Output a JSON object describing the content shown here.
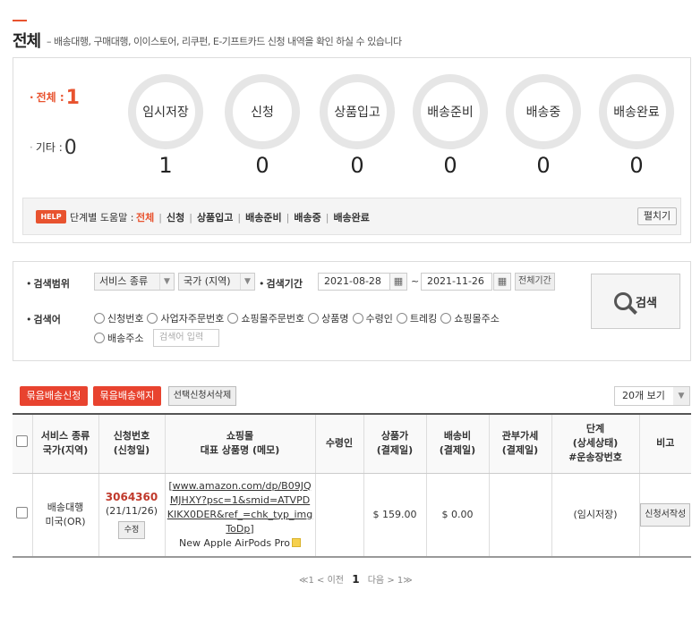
{
  "header": {
    "title": "전체",
    "description": "– 배송대행, 구매대행, 이이스토어, 리쿠펀, E-기프트카드 신청 내역을 확인 하실 수 있습니다"
  },
  "summary": {
    "total_label": "전체 :",
    "total_count": "1",
    "other_label": "기타 :",
    "other_count": "0",
    "stages": [
      {
        "label": "임시저장",
        "count": "1"
      },
      {
        "label": "신청",
        "count": "0"
      },
      {
        "label": "상품입고",
        "count": "0"
      },
      {
        "label": "배송준비",
        "count": "0"
      },
      {
        "label": "배송중",
        "count": "0"
      },
      {
        "label": "배송완료",
        "count": "0"
      }
    ]
  },
  "help": {
    "badge": "HELP",
    "label": "단계별 도움말 :",
    "links": [
      "전체",
      "신청",
      "상품입고",
      "배송준비",
      "배송중",
      "배송완료"
    ],
    "fold_button": "펼치기"
  },
  "search": {
    "range_label": "검색범위",
    "service_select": "서비스 종류",
    "country_select": "국가 (지역)",
    "period_label": "검색기간",
    "date_from": "2021-08-28",
    "date_to": "2021-11-26",
    "tilde": "~",
    "all_period_button": "전체기간",
    "search_button": "검색",
    "keyword_label": "검색어",
    "radio_options": [
      "신청번호",
      "사업자주문번호",
      "쇼핑몰주문번호",
      "상품명",
      "수령인",
      "트레킹",
      "쇼핑몰주소",
      "배송주소"
    ],
    "keyword_placeholder": "검색어 입력"
  },
  "actions": {
    "bundle_request": "묶음배송신청",
    "bundle_cancel": "묶음배송해지",
    "delete_selected": "선택신청서삭제",
    "per_page": "20개 보기"
  },
  "table": {
    "headers": {
      "service": [
        "서비스 종류",
        "국가(지역)"
      ],
      "app_no": [
        "신청번호",
        "(신청일)"
      ],
      "mall": [
        "쇼핑몰",
        "대표 상품명 (메모)"
      ],
      "receiver": [
        "수령인"
      ],
      "price": [
        "상품가",
        "(결제일)"
      ],
      "shipping": [
        "배송비",
        "(결제일)"
      ],
      "tax": [
        "관부가세",
        "(결제일)"
      ],
      "stage": [
        "단계",
        "(상세상태)",
        "#운송장번호"
      ],
      "note": [
        "비고"
      ]
    },
    "rows": [
      {
        "service": "배송대행",
        "country": "미국(OR)",
        "app_no": "3064360",
        "app_date": "(21/11/26)",
        "edit": "수정",
        "mall_url": "[www.amazon.com/dp/B09JQMJHXY?psc=1&smid=ATVPDKIKX0DER&ref_=chk_typ_imgToDp]",
        "product": "New Apple AirPods Pro",
        "receiver": "",
        "price": "$ 159.00",
        "shipping": "$ 0.00",
        "tax": "",
        "stage": "(임시저장)",
        "note_button": "신청서작성"
      }
    ]
  },
  "pager": {
    "first": "≪1",
    "prev": "< 이전",
    "current": "1",
    "next": "다음 >",
    "last": "1≫"
  }
}
